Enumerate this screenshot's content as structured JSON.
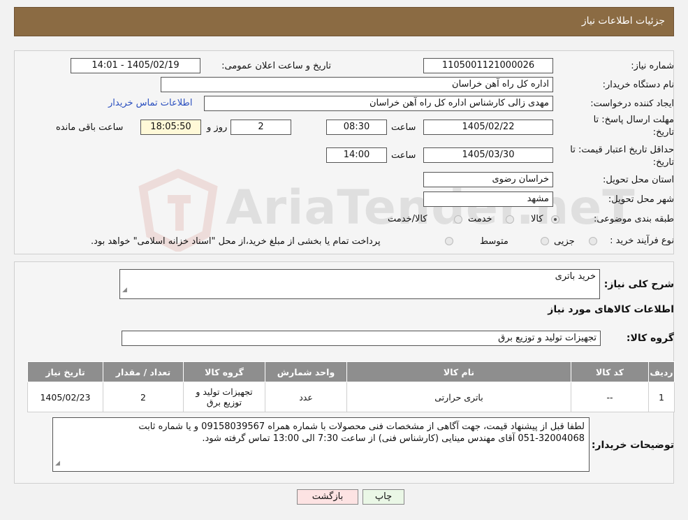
{
  "header": {
    "title": "جزئیات اطلاعات نیاز"
  },
  "form": {
    "need_number_label": "شماره نیاز:",
    "need_number": "1105001121000026",
    "announce_label": "تاریخ و ساعت اعلان عمومی:",
    "announce_value": "1405/02/19 - 14:01",
    "buyer_label": "نام دستگاه خریدار:",
    "buyer_value": "اداره کل راه آهن خراسان",
    "creator_label": "ایجاد کننده درخواست:",
    "creator_value": "مهدی زالی کارشناس اداره کل راه آهن خراسان",
    "contact_link": "اطلاعات تماس خریدار",
    "deadline_label_1": "مهلت ارسال پاسخ: تا",
    "deadline_label_2": "تاریخ:",
    "deadline_date": "1405/02/22",
    "time_label": "ساعت",
    "deadline_time": "08:30",
    "days_value": "2",
    "days_label": "روز و",
    "remaining_time": "18:05:50",
    "remaining_label": "ساعت باقی مانده",
    "validity_label_1": "حداقل تاریخ اعتبار قیمت: تا",
    "validity_label_2": "تاریخ:",
    "validity_date": "1405/03/30",
    "validity_time": "14:00",
    "province_label": "استان محل تحویل:",
    "province_value": "خراسان رضوی",
    "city_label": "شهر محل تحویل:",
    "city_value": "مشهد",
    "category_label": "طبقه بندی موضوعی:",
    "category_options": [
      "کالا",
      "خدمت",
      "کالا/خدمت"
    ],
    "process_label": "نوع فرآیند خرید :",
    "process_options": [
      "جزیی",
      "متوسط"
    ],
    "process_note": "پرداخت تمام یا بخشی از مبلغ خرید،از محل \"اسناد خزانه اسلامی\" خواهد بود."
  },
  "summary": {
    "desc_label": "شرح کلی نیاز:",
    "desc_value": "خرید باتری",
    "goods_info_title": "اطلاعات کالاهای مورد نیاز",
    "group_label": "گروه کالا:",
    "group_value": "تجهیزات تولید و توزیع برق"
  },
  "table": {
    "headers": [
      "ردیف",
      "کد کالا",
      "نام کالا",
      "واحد شمارش",
      "گروه کالا",
      "تعداد / مقدار",
      "تاریخ نیاز"
    ],
    "rows": [
      [
        "1",
        "--",
        "باتری حرارتی",
        "عدد",
        "تجهیزات تولید و توزیع برق",
        "2",
        "1405/02/23"
      ]
    ]
  },
  "notes": {
    "label": "توضیحات خریدار:",
    "line1": "لطفا قبل از پیشنهاد قیمت، جهت آگاهی از مشخصات فنی محصولات با شماره همراه    09158039567 و یا شماره ثابت",
    "line2": "051-32004068 آقای مهندس مینایی   (کارشناس فنی) از ساعت 7:30  الی 13:00  تماس گرفته شود."
  },
  "buttons": {
    "print": "چاپ",
    "back": "بازگشت"
  },
  "watermark": "AriaTender.neT",
  "colors": {
    "header_bg": "#8b6b43",
    "table_header_bg": "#8e8e8e",
    "link": "#2a4fbf",
    "remaining_bg": "#fff9d8",
    "back_bg": "#fde3e3",
    "print_bg": "#eaf7e6"
  }
}
